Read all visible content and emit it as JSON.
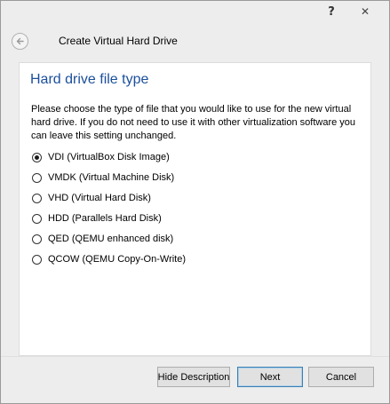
{
  "titlebar": {
    "help_label": "?",
    "close_label": "✕"
  },
  "header": {
    "back_icon": "back-arrow-icon",
    "title": "Create Virtual Hard Drive"
  },
  "page": {
    "title": "Hard drive file type",
    "description": "Please choose the type of file that you would like to use for the new virtual hard drive. If you do not need to use it with other virtualization software you can leave this setting unchanged."
  },
  "options": [
    {
      "label": "VDI (VirtualBox Disk Image)",
      "checked": true
    },
    {
      "label": "VMDK (Virtual Machine Disk)",
      "checked": false
    },
    {
      "label": "VHD (Virtual Hard Disk)",
      "checked": false
    },
    {
      "label": "HDD (Parallels Hard Disk)",
      "checked": false
    },
    {
      "label": "QED (QEMU enhanced disk)",
      "checked": false
    },
    {
      "label": "QCOW (QEMU Copy-On-Write)",
      "checked": false
    }
  ],
  "buttons": {
    "hide_description": "Hide Description",
    "next": "Next",
    "cancel": "Cancel"
  }
}
